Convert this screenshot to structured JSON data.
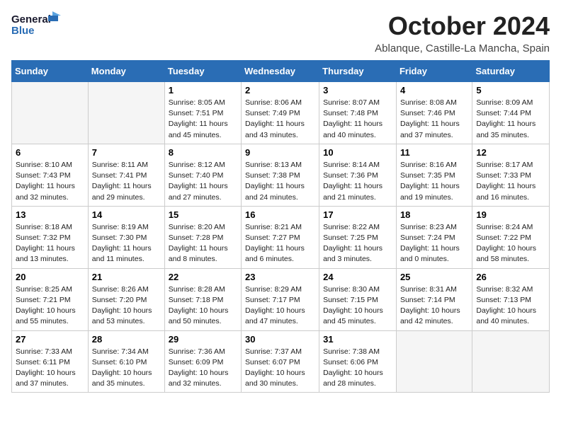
{
  "header": {
    "logo_general": "General",
    "logo_blue": "Blue",
    "title": "October 2024",
    "subtitle": "Ablanque, Castille-La Mancha, Spain"
  },
  "days_of_week": [
    "Sunday",
    "Monday",
    "Tuesday",
    "Wednesday",
    "Thursday",
    "Friday",
    "Saturday"
  ],
  "weeks": [
    [
      {
        "day": "",
        "sunrise": "",
        "sunset": "",
        "daylight": ""
      },
      {
        "day": "",
        "sunrise": "",
        "sunset": "",
        "daylight": ""
      },
      {
        "day": "1",
        "sunrise": "Sunrise: 8:05 AM",
        "sunset": "Sunset: 7:51 PM",
        "daylight": "Daylight: 11 hours and 45 minutes."
      },
      {
        "day": "2",
        "sunrise": "Sunrise: 8:06 AM",
        "sunset": "Sunset: 7:49 PM",
        "daylight": "Daylight: 11 hours and 43 minutes."
      },
      {
        "day": "3",
        "sunrise": "Sunrise: 8:07 AM",
        "sunset": "Sunset: 7:48 PM",
        "daylight": "Daylight: 11 hours and 40 minutes."
      },
      {
        "day": "4",
        "sunrise": "Sunrise: 8:08 AM",
        "sunset": "Sunset: 7:46 PM",
        "daylight": "Daylight: 11 hours and 37 minutes."
      },
      {
        "day": "5",
        "sunrise": "Sunrise: 8:09 AM",
        "sunset": "Sunset: 7:44 PM",
        "daylight": "Daylight: 11 hours and 35 minutes."
      }
    ],
    [
      {
        "day": "6",
        "sunrise": "Sunrise: 8:10 AM",
        "sunset": "Sunset: 7:43 PM",
        "daylight": "Daylight: 11 hours and 32 minutes."
      },
      {
        "day": "7",
        "sunrise": "Sunrise: 8:11 AM",
        "sunset": "Sunset: 7:41 PM",
        "daylight": "Daylight: 11 hours and 29 minutes."
      },
      {
        "day": "8",
        "sunrise": "Sunrise: 8:12 AM",
        "sunset": "Sunset: 7:40 PM",
        "daylight": "Daylight: 11 hours and 27 minutes."
      },
      {
        "day": "9",
        "sunrise": "Sunrise: 8:13 AM",
        "sunset": "Sunset: 7:38 PM",
        "daylight": "Daylight: 11 hours and 24 minutes."
      },
      {
        "day": "10",
        "sunrise": "Sunrise: 8:14 AM",
        "sunset": "Sunset: 7:36 PM",
        "daylight": "Daylight: 11 hours and 21 minutes."
      },
      {
        "day": "11",
        "sunrise": "Sunrise: 8:16 AM",
        "sunset": "Sunset: 7:35 PM",
        "daylight": "Daylight: 11 hours and 19 minutes."
      },
      {
        "day": "12",
        "sunrise": "Sunrise: 8:17 AM",
        "sunset": "Sunset: 7:33 PM",
        "daylight": "Daylight: 11 hours and 16 minutes."
      }
    ],
    [
      {
        "day": "13",
        "sunrise": "Sunrise: 8:18 AM",
        "sunset": "Sunset: 7:32 PM",
        "daylight": "Daylight: 11 hours and 13 minutes."
      },
      {
        "day": "14",
        "sunrise": "Sunrise: 8:19 AM",
        "sunset": "Sunset: 7:30 PM",
        "daylight": "Daylight: 11 hours and 11 minutes."
      },
      {
        "day": "15",
        "sunrise": "Sunrise: 8:20 AM",
        "sunset": "Sunset: 7:28 PM",
        "daylight": "Daylight: 11 hours and 8 minutes."
      },
      {
        "day": "16",
        "sunrise": "Sunrise: 8:21 AM",
        "sunset": "Sunset: 7:27 PM",
        "daylight": "Daylight: 11 hours and 6 minutes."
      },
      {
        "day": "17",
        "sunrise": "Sunrise: 8:22 AM",
        "sunset": "Sunset: 7:25 PM",
        "daylight": "Daylight: 11 hours and 3 minutes."
      },
      {
        "day": "18",
        "sunrise": "Sunrise: 8:23 AM",
        "sunset": "Sunset: 7:24 PM",
        "daylight": "Daylight: 11 hours and 0 minutes."
      },
      {
        "day": "19",
        "sunrise": "Sunrise: 8:24 AM",
        "sunset": "Sunset: 7:22 PM",
        "daylight": "Daylight: 10 hours and 58 minutes."
      }
    ],
    [
      {
        "day": "20",
        "sunrise": "Sunrise: 8:25 AM",
        "sunset": "Sunset: 7:21 PM",
        "daylight": "Daylight: 10 hours and 55 minutes."
      },
      {
        "day": "21",
        "sunrise": "Sunrise: 8:26 AM",
        "sunset": "Sunset: 7:20 PM",
        "daylight": "Daylight: 10 hours and 53 minutes."
      },
      {
        "day": "22",
        "sunrise": "Sunrise: 8:28 AM",
        "sunset": "Sunset: 7:18 PM",
        "daylight": "Daylight: 10 hours and 50 minutes."
      },
      {
        "day": "23",
        "sunrise": "Sunrise: 8:29 AM",
        "sunset": "Sunset: 7:17 PM",
        "daylight": "Daylight: 10 hours and 47 minutes."
      },
      {
        "day": "24",
        "sunrise": "Sunrise: 8:30 AM",
        "sunset": "Sunset: 7:15 PM",
        "daylight": "Daylight: 10 hours and 45 minutes."
      },
      {
        "day": "25",
        "sunrise": "Sunrise: 8:31 AM",
        "sunset": "Sunset: 7:14 PM",
        "daylight": "Daylight: 10 hours and 42 minutes."
      },
      {
        "day": "26",
        "sunrise": "Sunrise: 8:32 AM",
        "sunset": "Sunset: 7:13 PM",
        "daylight": "Daylight: 10 hours and 40 minutes."
      }
    ],
    [
      {
        "day": "27",
        "sunrise": "Sunrise: 7:33 AM",
        "sunset": "Sunset: 6:11 PM",
        "daylight": "Daylight: 10 hours and 37 minutes."
      },
      {
        "day": "28",
        "sunrise": "Sunrise: 7:34 AM",
        "sunset": "Sunset: 6:10 PM",
        "daylight": "Daylight: 10 hours and 35 minutes."
      },
      {
        "day": "29",
        "sunrise": "Sunrise: 7:36 AM",
        "sunset": "Sunset: 6:09 PM",
        "daylight": "Daylight: 10 hours and 32 minutes."
      },
      {
        "day": "30",
        "sunrise": "Sunrise: 7:37 AM",
        "sunset": "Sunset: 6:07 PM",
        "daylight": "Daylight: 10 hours and 30 minutes."
      },
      {
        "day": "31",
        "sunrise": "Sunrise: 7:38 AM",
        "sunset": "Sunset: 6:06 PM",
        "daylight": "Daylight: 10 hours and 28 minutes."
      },
      {
        "day": "",
        "sunrise": "",
        "sunset": "",
        "daylight": ""
      },
      {
        "day": "",
        "sunrise": "",
        "sunset": "",
        "daylight": ""
      }
    ]
  ]
}
